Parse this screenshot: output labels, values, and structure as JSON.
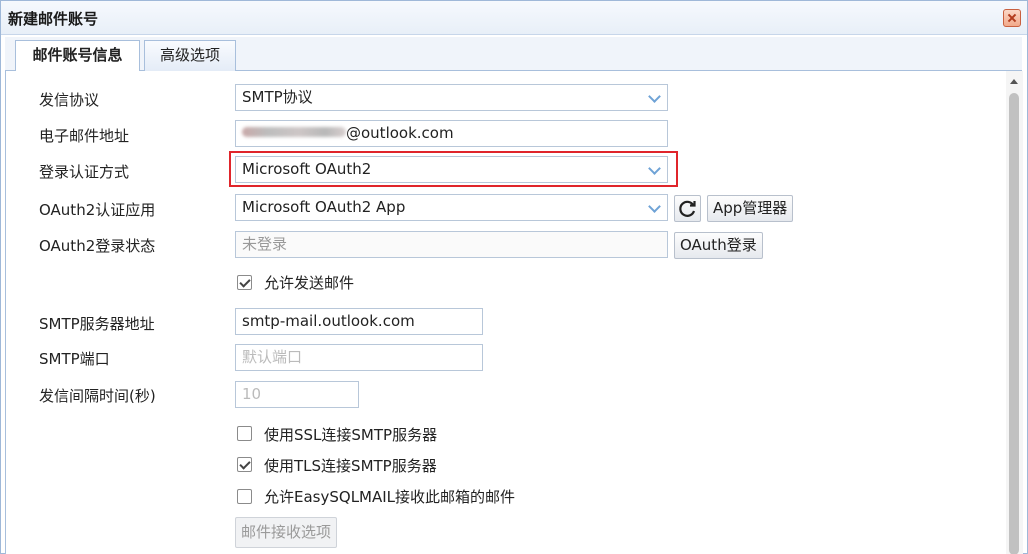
{
  "window": {
    "title": "新建邮件账号"
  },
  "tabs": [
    {
      "label": "邮件账号信息",
      "active": true
    },
    {
      "label": "高级选项",
      "active": false
    }
  ],
  "form": {
    "protocol": {
      "label": "发信协议",
      "value": "SMTP协议"
    },
    "email": {
      "label": "电子邮件地址",
      "value_suffix": "@outlook.com"
    },
    "auth_method": {
      "label": "登录认证方式",
      "value": "Microsoft OAuth2"
    },
    "oauth_app": {
      "label": "OAuth2认证应用",
      "value": "Microsoft OAuth2 App",
      "manager_button": "App管理器"
    },
    "oauth_status": {
      "label": "OAuth2登录状态",
      "value": "未登录",
      "login_button": "OAuth登录"
    },
    "allow_send": {
      "label": "允许发送邮件",
      "checked": true
    },
    "smtp_server": {
      "label": "SMTP服务器地址",
      "value": "smtp-mail.outlook.com"
    },
    "smtp_port": {
      "label": "SMTP端口",
      "placeholder": "默认端口"
    },
    "send_interval": {
      "label": "发信间隔时间(秒)",
      "placeholder": "10"
    },
    "use_ssl": {
      "label": "使用SSL连接SMTP服务器",
      "checked": false
    },
    "use_tls": {
      "label": "使用TLS连接SMTP服务器",
      "checked": true
    },
    "allow_receive": {
      "label": "允许EasySQLMAIL接收此邮箱的邮件",
      "checked": false
    },
    "receive_options_button": "邮件接收选项"
  },
  "colors": {
    "highlight_border": "#e0252b",
    "combo_arrow": "#6fa3d6",
    "tab_border": "#a8bfdc"
  },
  "icons": [
    "close-icon",
    "chevron-down-icon",
    "refresh-icon",
    "checkmark-icon",
    "scroll-up-icon"
  ]
}
